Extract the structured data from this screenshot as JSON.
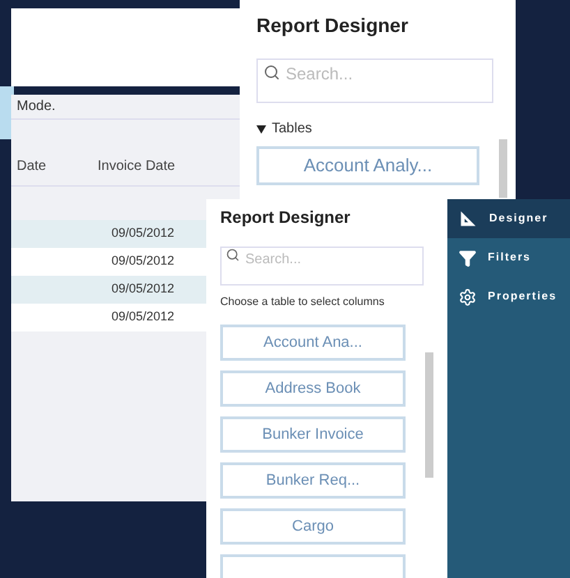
{
  "back_window": {
    "toolbar_text": "Mode.",
    "table": {
      "columns": [
        "Date",
        "Invoice Date"
      ],
      "rows": [
        {
          "selected": true,
          "cells": [
            "",
            "09/05/2012"
          ]
        },
        {
          "selected": false,
          "cells": [
            "",
            "09/05/2012"
          ]
        },
        {
          "selected": true,
          "cells": [
            "",
            "09/05/2012"
          ]
        },
        {
          "selected": false,
          "cells": [
            "",
            "09/05/2012"
          ]
        }
      ]
    }
  },
  "back_designer": {
    "title": "Report Designer",
    "search": {
      "placeholder": "Search..."
    },
    "section": {
      "label": "Tables",
      "expanded": true
    },
    "tables": [
      "Account Analy..."
    ]
  },
  "front_designer": {
    "title": "Report Designer",
    "search": {
      "placeholder": "Search..."
    },
    "hint": "Choose a table to select columns",
    "tables": [
      "Account Ana...",
      "Address Book",
      "Bunker Invoice",
      "Bunker Req...",
      "Cargo"
    ]
  },
  "sidebar": {
    "items": [
      {
        "kind": "designer",
        "label": "Designer",
        "selected": true
      },
      {
        "kind": "filters",
        "label": "Filters",
        "selected": false
      },
      {
        "kind": "properties",
        "label": "Properties",
        "selected": false
      }
    ]
  }
}
